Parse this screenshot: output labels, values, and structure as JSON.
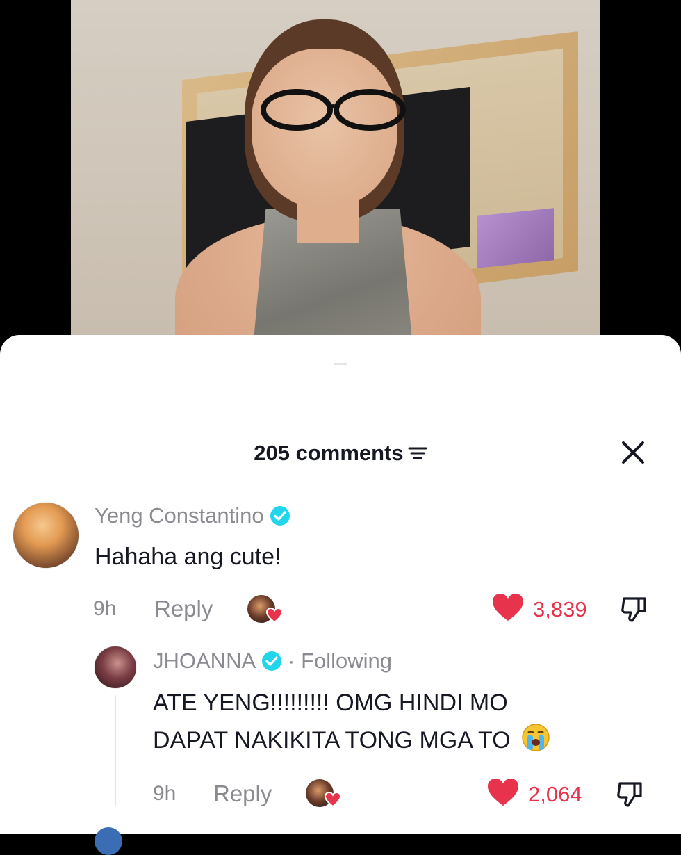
{
  "header": {
    "comments_label": "205 comments"
  },
  "comments": [
    {
      "username": "Yeng Constantino",
      "verified": true,
      "text": "Hahaha ang cute!",
      "time": "9h",
      "reply_label": "Reply",
      "likes": "3,839",
      "creator_liked": true
    },
    {
      "username": "JHOANNA",
      "verified": true,
      "following_label": "· Following",
      "text_line1": "ATE YENG!!!!!!!!! OMG HINDI MO",
      "text_line2": "DAPAT NAKIKITA TONG MGA TO",
      "emoji": "loudly-crying-face",
      "time": "9h",
      "reply_label": "Reply",
      "likes": "2,064",
      "creator_liked": true
    }
  ],
  "colors": {
    "like_red": "#e8334d",
    "verified_blue": "#20d5ec",
    "muted_text": "#8a8b91",
    "primary_text": "#161823"
  }
}
